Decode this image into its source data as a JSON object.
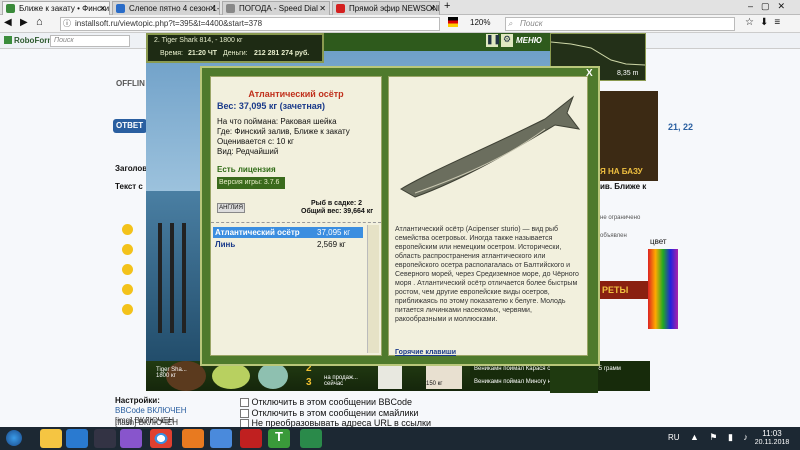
{
  "browser": {
    "tabs": [
      {
        "label": "Ближе к закату • Финский з",
        "color": "#3a8a3a"
      },
      {
        "label": "Слепое пятно 4 сезон 1-5,6",
        "color": "#2a6cc8"
      },
      {
        "label": "ПОГОДА - Speed Dial",
        "color": "#888888"
      },
      {
        "label": "Прямой эфир NEWSONE",
        "color": "#d42020"
      }
    ],
    "url": "installsoft.ru/viewtopic.php?t=395&t=4400&start=378",
    "zoom": "120%",
    "search_placeholder": "Поиск",
    "roboform": "RoboForm",
    "roboform_search": "Поиск"
  },
  "forum": {
    "offline": "OFFLIN",
    "answer": "ОТВЕТ",
    "subject": "Заголов",
    "text": "Текст с",
    "settings": "Настройки:",
    "options": [
      {
        "label": "BBCode ВКЛЮЧЕН"
      },
      {
        "label": "[img] ВКЛЮЧЕН"
      },
      {
        "label": "[flash] ВКЛЮЧЕН"
      }
    ],
    "checks": [
      "Отключить в этом сообщении BBCode",
      "Отключить в этом сообщении смайлики",
      "Не преобразовывать адреса URL в ссылки"
    ],
    "right_fragments": [
      "21, 22",
      "ив. Ближе к",
      "Я НА БАЗУ",
      "не ограничено",
      "объявлен",
      "цвет",
      "РЕТЫ"
    ]
  },
  "game": {
    "top": {
      "place": "2. Tiger Shark 814, - 1800 кг",
      "time_label": "Время:",
      "time": "21:20 ЧТ",
      "money_label": "Деньги:",
      "money": "212 281 274 руб."
    },
    "menu_label": "МЕНЮ",
    "depth": "8,35 m",
    "fish_card": {
      "name": "Атлантический осётр",
      "weight": "Вес: 37,095 кг (зачетная)",
      "bait": "На что поймана: Раковая шейка",
      "place": "Где: Финский залив, Ближе к закату",
      "price": "Оценивается с: 10 кг",
      "rarity": "Вид: Редчайший",
      "license": "Есть лицензия",
      "version": "Версия игры: 3.7.6"
    },
    "cage": {
      "logo": "АНГЛИЯ",
      "count": "Рыб в садке: 2",
      "total": "Общий вес: 39,664 кг"
    },
    "catch_list": [
      {
        "name": "Атлантический осётр",
        "weight": "37,095 кг"
      },
      {
        "name": "Линь",
        "weight": "2,569 кг"
      }
    ],
    "description": "Атлантический осётр (Acipenser sturio) — вид рыб семейства осетровых. Иногда также называется европейским или немецким осетром. Исторически, область распространения атлантического или европейского осетра располагалась от Балтийского и Северного морей, через Средиземное море, до Чёрного моря . Атлантический осётр отличается более быстрым ростом, чем другие европейские виды осетров, приближаясь по этому показателю к белуге. Молодь питается личинками насекомых, червями, ракообразными и моллюсками.",
    "hotkeys": "Горячие клавиши",
    "close": "X",
    "bottom": {
      "slot2": "2",
      "slot3": "3",
      "shark": "Tiger Sha... 1800 кг",
      "sell": "на продаж... сейчас",
      "price_tag": "150 кг",
      "news1": "Веникамн поймал Карася серебряного на 445 грамм",
      "news2": "Веникамн поймал Миногу на 23 грамм"
    }
  },
  "taskbar": {
    "lang": "RU",
    "time": "11:03",
    "date": "20.11.2018"
  },
  "colors": {
    "dialog_bg": "#4f7a2c",
    "pane_bg": "#f2f0dd",
    "fish_name": "#c0301c",
    "weight": "#1a3a8a",
    "license": "#2d6a14",
    "highlight": "#3b8ee0"
  }
}
